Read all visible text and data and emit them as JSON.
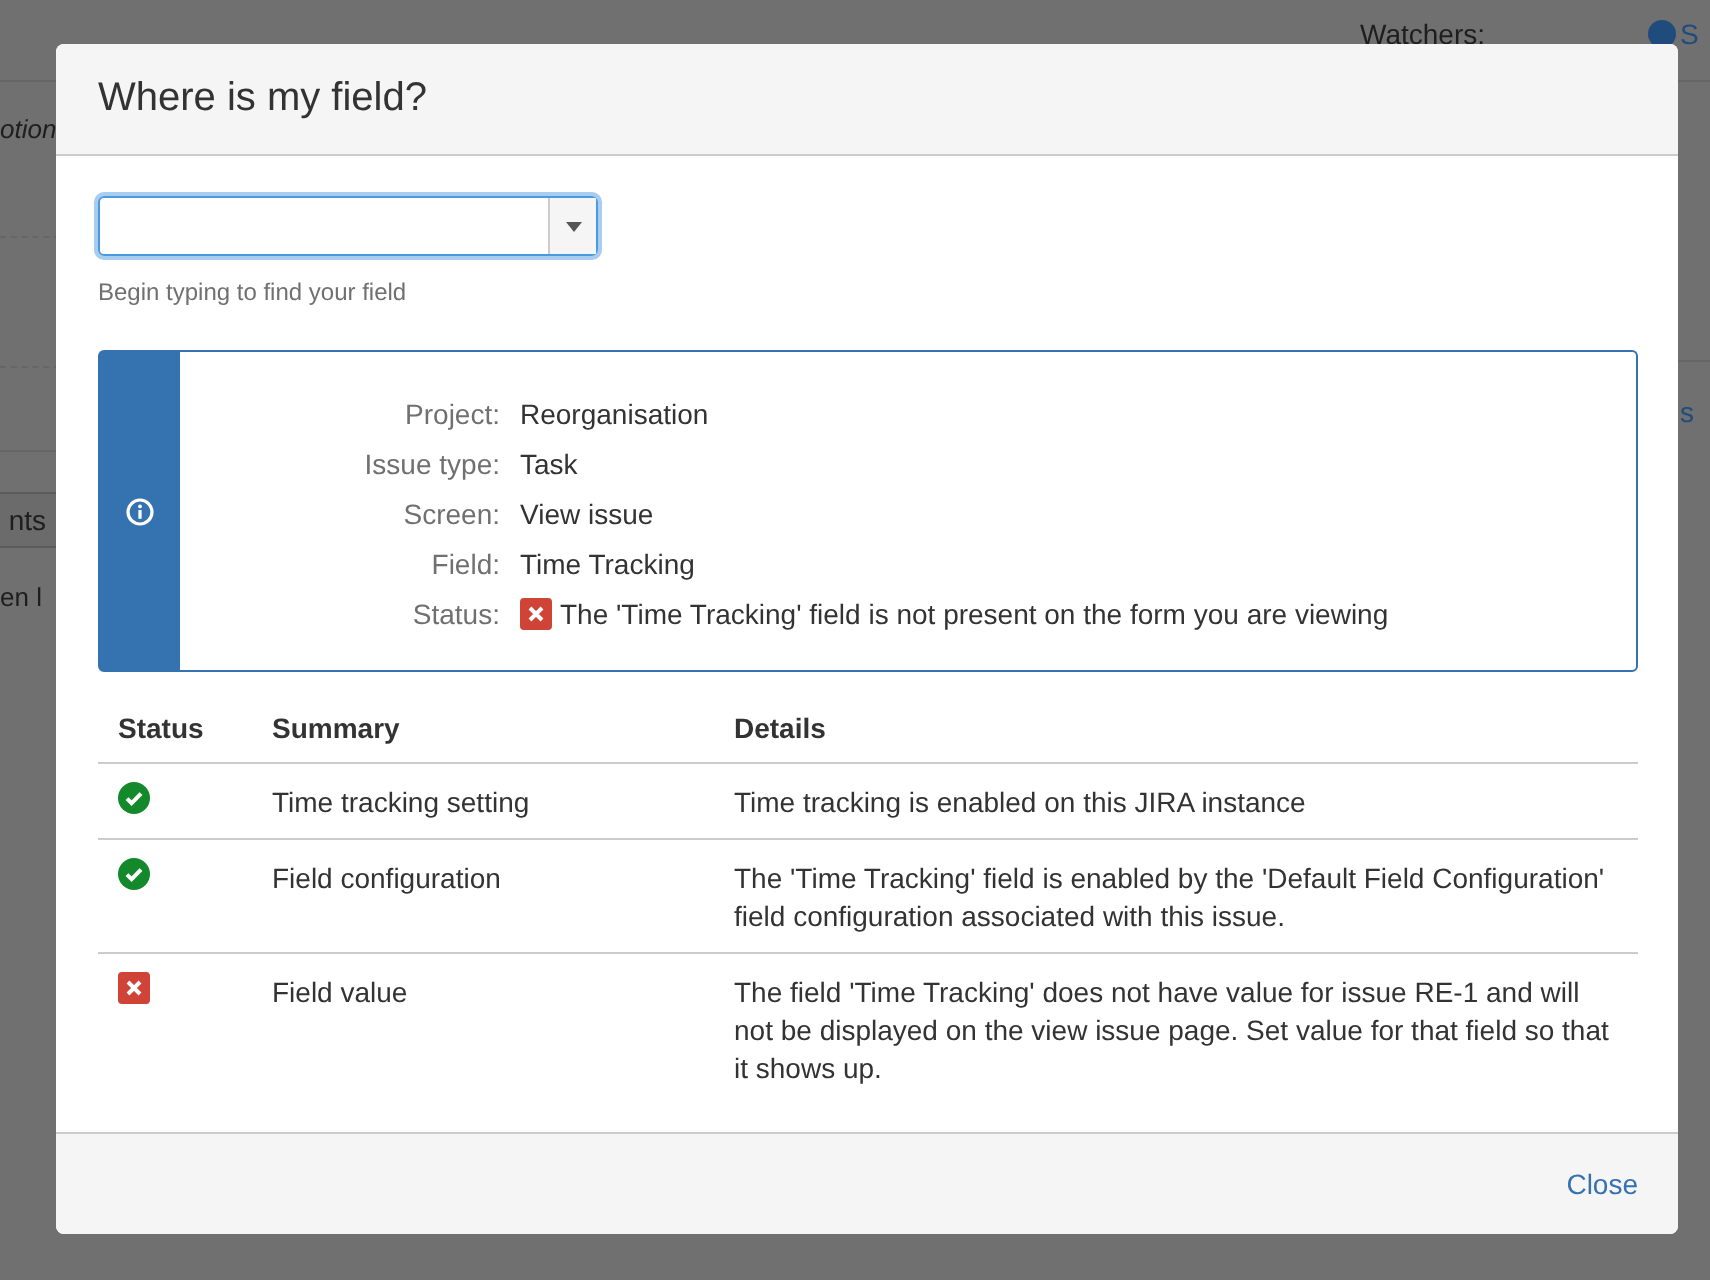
{
  "background": {
    "left_texts": [
      {
        "kind": "italic",
        "text": "otion"
      },
      {
        "kind": "tab",
        "text": "nts"
      },
      {
        "kind": "plain",
        "text": "en l"
      }
    ],
    "right_texts": [
      {
        "kind": "label",
        "text": "Watchers:"
      },
      {
        "kind": "user",
        "text": "S"
      },
      {
        "kind": "link",
        "text": "s"
      }
    ]
  },
  "dialog": {
    "title": "Where is my field?",
    "search": {
      "hint": "Begin typing to find your field"
    },
    "info": [
      {
        "label": "Project:",
        "value": "Reorganisation"
      },
      {
        "label": "Issue type:",
        "value": "Task"
      },
      {
        "label": "Screen:",
        "value": "View issue"
      },
      {
        "label": "Field:",
        "value": "Time Tracking"
      },
      {
        "label": "Status:",
        "value": "The 'Time Tracking' field is not present on the form you are viewing",
        "passed": false
      }
    ],
    "table": {
      "columns": [
        "Status",
        "Summary",
        "Details"
      ],
      "rows": [
        {
          "passed": true,
          "summary": "Time tracking setting",
          "details": "Time tracking is enabled on this JIRA instance"
        },
        {
          "passed": true,
          "summary": "Field configuration",
          "details": "The 'Time Tracking' field is enabled by the 'Default Field Configuration' field configuration associated with this issue."
        },
        {
          "passed": false,
          "summary": "Field value",
          "details": "The field 'Time Tracking' does not have value for issue RE-1 and will not be displayed on the view issue page. Set value for that field so that it shows up."
        }
      ]
    },
    "close_button": "Close"
  }
}
